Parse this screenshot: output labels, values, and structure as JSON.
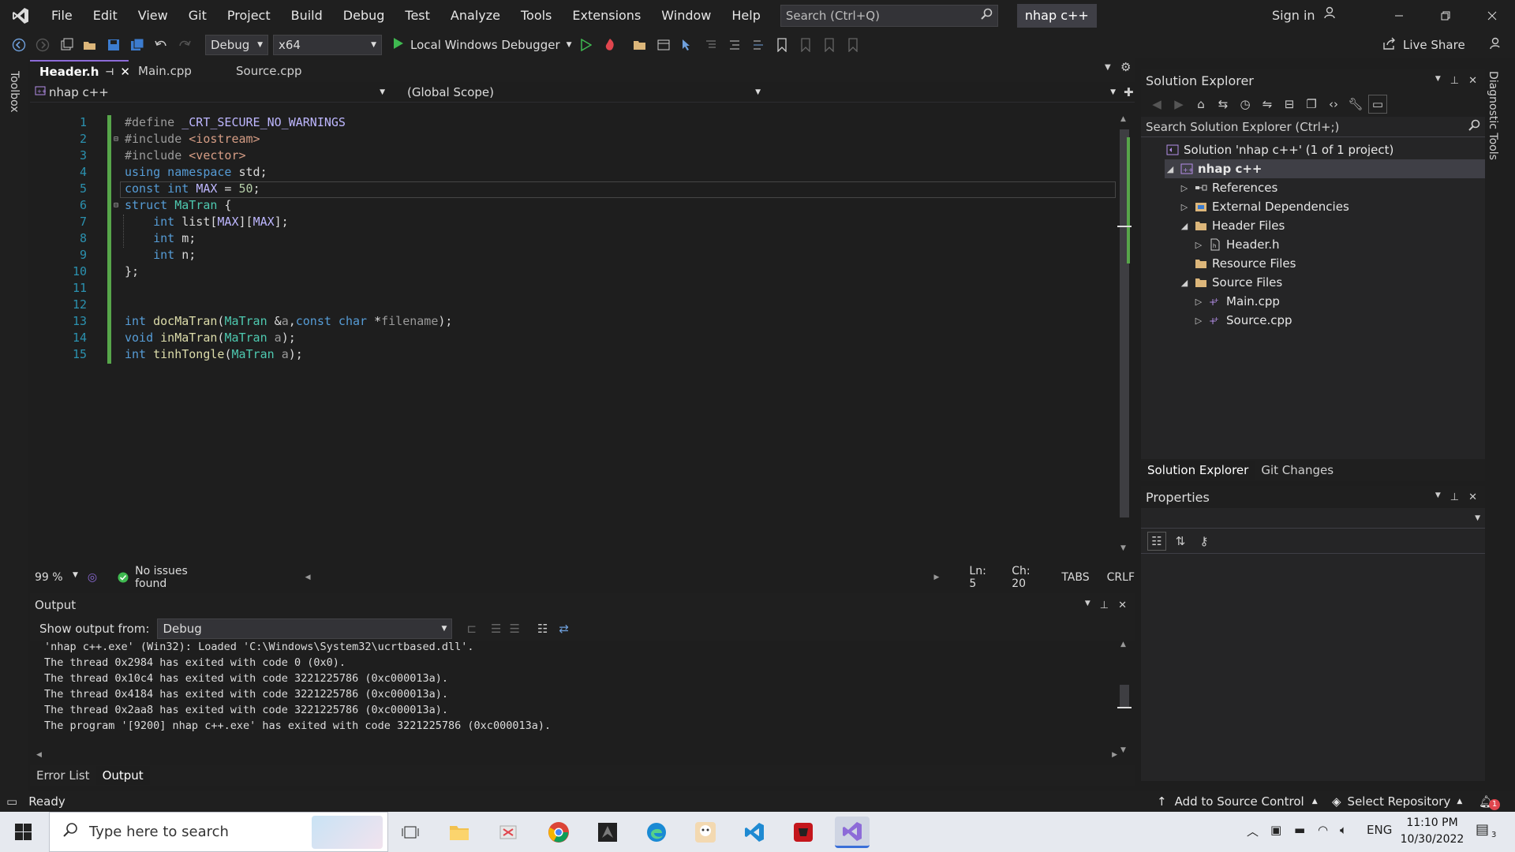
{
  "title_bar": {
    "menu": [
      "File",
      "Edit",
      "View",
      "Git",
      "Project",
      "Build",
      "Debug",
      "Test",
      "Analyze",
      "Tools",
      "Extensions",
      "Window",
      "Help"
    ],
    "search_placeholder": "Search (Ctrl+Q)",
    "solution_name": "nhap c++",
    "sign_in": "Sign in"
  },
  "toolbar": {
    "configuration": "Debug",
    "platform": "x64",
    "debugger": "Local Windows Debugger",
    "live_share": "Live Share"
  },
  "left_strip": {
    "toolbox": "Toolbox"
  },
  "right_strip": {
    "diagnostic": "Diagnostic Tools"
  },
  "editor": {
    "tabs": [
      {
        "label": "Header.h",
        "active": true
      },
      {
        "label": "Main.cpp",
        "active": false
      },
      {
        "label": "Source.cpp",
        "active": false
      }
    ],
    "project_dropdown": "nhap c++",
    "scope_dropdown": "(Global Scope)",
    "lines": [
      {
        "n": "1",
        "tokens": [
          [
            "pp",
            "#define "
          ],
          [
            "mac",
            "_CRT_SECURE_NO_WARNINGS"
          ]
        ]
      },
      {
        "n": "2",
        "tokens": [
          [
            "pp",
            "#include "
          ],
          [
            "str",
            "<iostream>"
          ]
        ]
      },
      {
        "n": "3",
        "tokens": [
          [
            "pp",
            "#include "
          ],
          [
            "str",
            "<vector>"
          ]
        ]
      },
      {
        "n": "4",
        "tokens": [
          [
            "kw",
            "using namespace "
          ],
          [
            "var",
            "std;"
          ]
        ]
      },
      {
        "n": "5",
        "tokens": [
          [
            "kw",
            "const int "
          ],
          [
            "mac",
            "MAX"
          ],
          [
            "var",
            " = "
          ],
          [
            "num",
            "50"
          ],
          [
            "var",
            ";"
          ]
        ]
      },
      {
        "n": "6",
        "tokens": [
          [
            "kw",
            "struct "
          ],
          [
            "ty",
            "MaTran"
          ],
          [
            "var",
            " {"
          ]
        ]
      },
      {
        "n": "7",
        "tokens": [
          [
            "var",
            "    "
          ],
          [
            "kw",
            "int "
          ],
          [
            "var",
            "list["
          ],
          [
            "mac",
            "MAX"
          ],
          [
            "var",
            "]["
          ],
          [
            "mac",
            "MAX"
          ],
          [
            "var",
            "];"
          ]
        ]
      },
      {
        "n": "8",
        "tokens": [
          [
            "var",
            "    "
          ],
          [
            "kw",
            "int "
          ],
          [
            "var",
            "m;"
          ]
        ]
      },
      {
        "n": "9",
        "tokens": [
          [
            "var",
            "    "
          ],
          [
            "kw",
            "int "
          ],
          [
            "var",
            "n;"
          ]
        ]
      },
      {
        "n": "10",
        "tokens": [
          [
            "var",
            "};"
          ]
        ]
      },
      {
        "n": "11",
        "tokens": []
      },
      {
        "n": "12",
        "tokens": []
      },
      {
        "n": "13",
        "tokens": [
          [
            "kw",
            "int "
          ],
          [
            "fn",
            "docMaTran"
          ],
          [
            "var",
            "("
          ],
          [
            "ty",
            "MaTran"
          ],
          [
            "var",
            " &"
          ],
          [
            "prm",
            "a"
          ],
          [
            "var",
            ","
          ],
          [
            "kw",
            "const char "
          ],
          [
            "var",
            "*"
          ],
          [
            "prm",
            "filename"
          ],
          [
            "var",
            ");"
          ]
        ]
      },
      {
        "n": "14",
        "tokens": [
          [
            "kw",
            "void "
          ],
          [
            "fn",
            "inMaTran"
          ],
          [
            "var",
            "("
          ],
          [
            "ty",
            "MaTran"
          ],
          [
            "var",
            " "
          ],
          [
            "prm",
            "a"
          ],
          [
            "var",
            ");"
          ]
        ]
      },
      {
        "n": "15",
        "tokens": [
          [
            "kw",
            "int "
          ],
          [
            "fn",
            "tinhTongle"
          ],
          [
            "var",
            "("
          ],
          [
            "ty",
            "MaTran"
          ],
          [
            "var",
            " "
          ],
          [
            "prm",
            "a"
          ],
          [
            "var",
            ");"
          ]
        ]
      }
    ],
    "zoom": "99 %",
    "issues": "No issues found",
    "ln": "Ln: 5",
    "ch": "Ch: 20",
    "tabs_mode": "TABS",
    "line_ending": "CRLF"
  },
  "output": {
    "title": "Output",
    "show_from_label": "Show output from:",
    "show_from_value": "Debug",
    "lines": [
      "'nhap c++.exe' (Win32): Loaded 'C:\\Windows\\System32\\ucrtbased.dll'.",
      "The thread 0x2984 has exited with code 0 (0x0).",
      "The thread 0x10c4 has exited with code 3221225786 (0xc000013a).",
      "The thread 0x4184 has exited with code 3221225786 (0xc000013a).",
      "The thread 0x2aa8 has exited with code 3221225786 (0xc000013a).",
      "The program '[9200] nhap c++.exe' has exited with code 3221225786 (0xc000013a)."
    ],
    "bottom_tabs": [
      {
        "label": "Error List",
        "active": false
      },
      {
        "label": "Output",
        "active": true
      }
    ]
  },
  "solution_explorer": {
    "title": "Solution Explorer",
    "search_placeholder": "Search Solution Explorer (Ctrl+;)",
    "tree": [
      {
        "label": "Solution 'nhap c++' (1 of 1 project)",
        "depth": 0,
        "arrow": "",
        "icon": "solution-icon"
      },
      {
        "label": "nhap c++",
        "depth": 1,
        "arrow": "open",
        "icon": "project-icon",
        "bold": true
      },
      {
        "label": "References",
        "depth": 2,
        "arrow": "closed",
        "icon": "references-icon"
      },
      {
        "label": "External Dependencies",
        "depth": 2,
        "arrow": "closed",
        "icon": "dependencies-icon"
      },
      {
        "label": "Header Files",
        "depth": 2,
        "arrow": "open",
        "icon": "folder-icon"
      },
      {
        "label": "Header.h",
        "depth": 3,
        "arrow": "closed",
        "icon": "header-file-icon"
      },
      {
        "label": "Resource Files",
        "depth": 2,
        "arrow": "",
        "icon": "folder-icon"
      },
      {
        "label": "Source Files",
        "depth": 2,
        "arrow": "open",
        "icon": "folder-icon"
      },
      {
        "label": "Main.cpp",
        "depth": 3,
        "arrow": "closed",
        "icon": "cpp-file-icon"
      },
      {
        "label": "Source.cpp",
        "depth": 3,
        "arrow": "closed",
        "icon": "cpp-file-icon"
      }
    ],
    "bottom_tabs": [
      {
        "label": "Solution Explorer",
        "active": true
      },
      {
        "label": "Git Changes",
        "active": false
      }
    ]
  },
  "properties": {
    "title": "Properties"
  },
  "status_bar": {
    "ready": "Ready",
    "source_control": "Add to Source Control",
    "repository": "Select Repository",
    "notifications": "1"
  },
  "taskbar": {
    "search_placeholder": "Type here to search",
    "language": "ENG",
    "time": "11:10 PM",
    "date": "10/30/2022",
    "notification_count": "3"
  },
  "colors": {
    "accent": "#8d6bd8",
    "line_number": "#2b91af",
    "keyword": "#569cd6",
    "type": "#4ec9b0",
    "function": "#dcdcaa",
    "change_bar": "#57a64a"
  }
}
